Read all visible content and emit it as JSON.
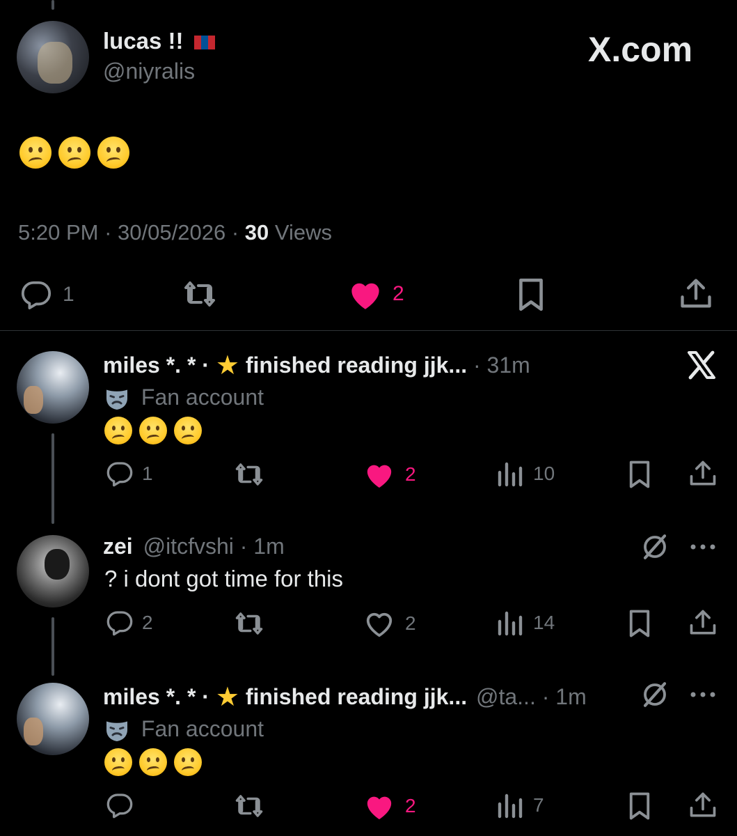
{
  "main_post": {
    "display_name": "lucas !!",
    "handle": "@niyralis",
    "brand": "X.com",
    "body_emojis": [
      "confused",
      "confused",
      "confused"
    ],
    "time": "5:20 PM",
    "sep": "·",
    "date": "30/05/2026",
    "views_count": "30",
    "views_label": "Views",
    "replies": "1",
    "likes": "2"
  },
  "reply1": {
    "display_name": "miles *. * ·",
    "name_suffix": "finished reading jjk...",
    "time": "· 31m",
    "label": "Fan account",
    "replies": "1",
    "likes": "2",
    "views": "10"
  },
  "reply2": {
    "display_name": "zei",
    "handle": "@itcfvshi",
    "time": "· 1m",
    "text": "? i dont got time for this",
    "replies": "2",
    "likes": "2",
    "views": "14"
  },
  "reply3": {
    "display_name": "miles *. * ·",
    "name_suffix": "finished reading jjk...",
    "handle": "@ta...",
    "time": "· 1m",
    "label": "Fan account",
    "likes": "2",
    "views": "7"
  },
  "colors": {
    "background": "#000000",
    "text": "#e7e9ea",
    "muted": "#71767b",
    "like_pink": "#f91880"
  },
  "icons": [
    "reply-icon",
    "repost-icon",
    "like-icon",
    "bookmark-icon",
    "share-icon",
    "views-icon",
    "x-logo-icon",
    "grok-icon",
    "more-icon",
    "fan-mask-icon",
    "star-icon",
    "mongolia-flag-icon"
  ]
}
